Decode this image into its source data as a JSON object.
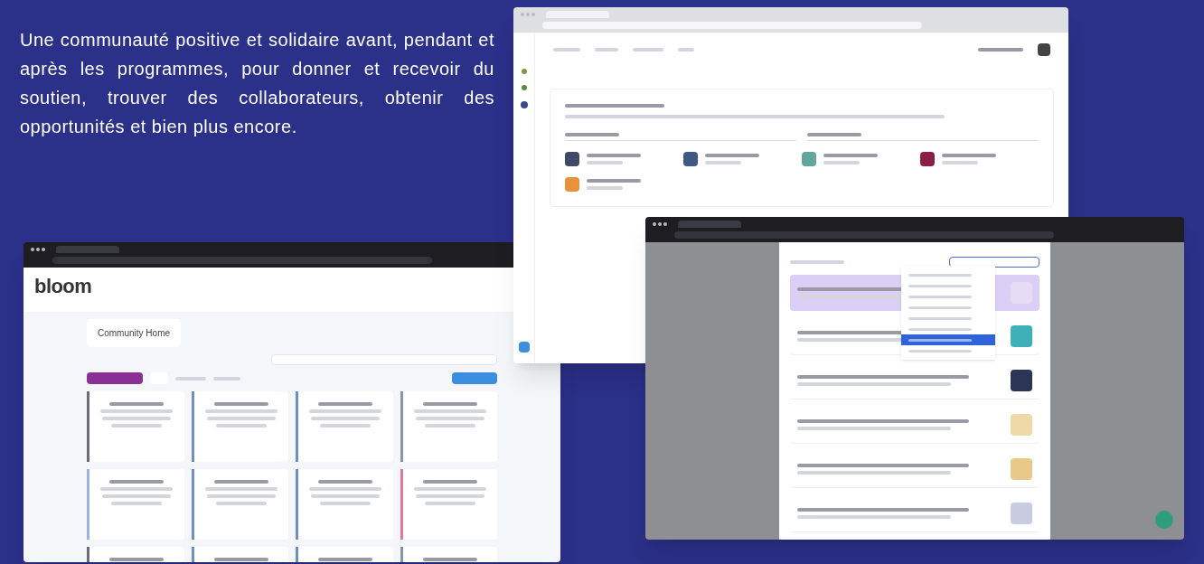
{
  "intro": {
    "text": "Une communauté positive et solidaire avant, pendant et après les programmes, pour donner et recevoir du soutien, trouver des collaborateurs, obtenir des opportunités et bien plus encore."
  },
  "windows": [
    {
      "kind": "community",
      "logo": "bloom",
      "page_title": "Community Home",
      "cards": [
        {
          "color": "#6b6b78"
        },
        {
          "color": "#6f8fc4"
        },
        {
          "color": "#6f8fc4"
        },
        {
          "color": "#8a94a8"
        },
        {
          "color": "#9bb3dc"
        },
        {
          "color": "#6f8fc4"
        },
        {
          "color": "#6f8fc4"
        },
        {
          "color": "#e07a9a"
        },
        {
          "color": "#6b6b78"
        },
        {
          "color": "#6f8fc4"
        },
        {
          "color": "#6f8fc4"
        },
        {
          "color": "#8a94a8"
        }
      ]
    },
    {
      "kind": "growth",
      "tiles": [
        {
          "color": "#3f4a66"
        },
        {
          "color": "#3f5a80"
        },
        {
          "color": "#5fa89a"
        },
        {
          "color": "#8a1f4a"
        },
        {
          "color": "#e8923a"
        }
      ]
    },
    {
      "kind": "modal",
      "rows": [
        {
          "selected": true,
          "color": "#e6dcf5"
        },
        {
          "selected": false,
          "color": "#3fb0b8"
        },
        {
          "selected": false,
          "color": "#2b3555"
        },
        {
          "selected": false,
          "color": "#f0d9a8"
        },
        {
          "selected": false,
          "color": "#e8c98a"
        },
        {
          "selected": false,
          "color": "#c9cbe0"
        }
      ],
      "options": [
        {
          "selected": false
        },
        {
          "selected": false
        },
        {
          "selected": false
        },
        {
          "selected": false
        },
        {
          "selected": false
        },
        {
          "selected": false
        },
        {
          "selected": true
        },
        {
          "selected": false
        }
      ]
    }
  ]
}
